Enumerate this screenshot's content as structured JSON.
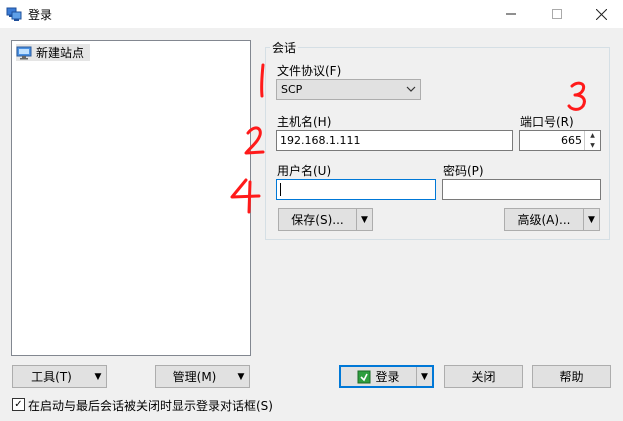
{
  "window": {
    "title": "登录",
    "controls": {
      "minimize": "—",
      "maximize": "☐",
      "close": "✕"
    }
  },
  "tree": {
    "items": [
      {
        "label": "新建站点",
        "icon": "monitor-icon"
      }
    ]
  },
  "session": {
    "group_title": "会话",
    "protocol_label": "文件协议(F)",
    "protocol_value": "SCP",
    "host_label": "主机名(H)",
    "host_value": "192.168.1.111",
    "port_label": "端口号(R)",
    "port_value": "665",
    "user_label": "用户名(U)",
    "user_value": "",
    "password_label": "密码(P)",
    "password_value": "",
    "save_label": "保存(S)...",
    "advanced_label": "高级(A)..."
  },
  "bottom": {
    "tools_label": "工具(T)",
    "manage_label": "管理(M)",
    "login_label": "登录",
    "close_label": "关闭",
    "help_label": "帮助",
    "checkbox_label": "在启动与最后会话被关闭时显示登录对话框(S)",
    "checkbox_checked": true
  },
  "annotations": {
    "color": "#ff1a1a",
    "marks": [
      "1",
      "2",
      "3",
      "4"
    ]
  },
  "colors": {
    "accent": "#0078d7",
    "window_bg": "#f0f0f0",
    "annotation": "#ff1a1a"
  }
}
